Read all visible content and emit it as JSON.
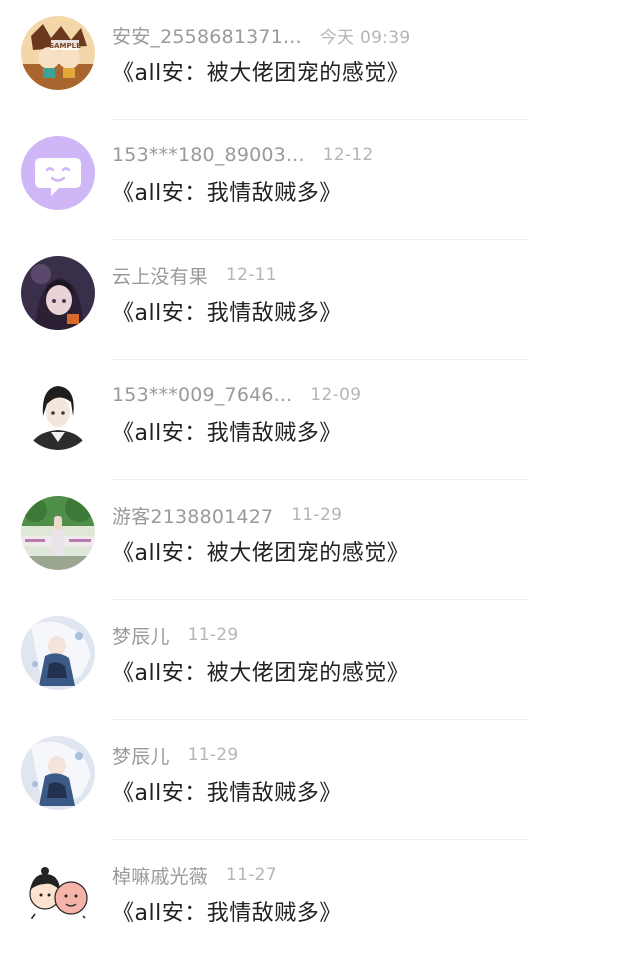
{
  "comments": [
    {
      "username": "安安_2558681371...",
      "time": "今天 09:39",
      "message": "《all安：被大佬团宠的感觉》",
      "avatar": "anime-sample-avatar",
      "avatar_text": "SAMPLE"
    },
    {
      "username": "153***180_89003...",
      "time": "12-12",
      "message": "《all安：我情敌贼多》",
      "avatar": "chat-bubble-avatar"
    },
    {
      "username": "云上没有果",
      "time": "12-11",
      "message": "《all安：我情敌贼多》",
      "avatar": "anime-girl-avatar"
    },
    {
      "username": "153***009_7646...",
      "time": "12-09",
      "message": "《all安：我情敌贼多》",
      "avatar": "anime-boy-avatar"
    },
    {
      "username": "游客2138801427",
      "time": "11-29",
      "message": "《all安：被大佬团宠的感觉》",
      "avatar": "photo-avatar"
    },
    {
      "username": "梦辰儿",
      "time": "11-29",
      "message": "《all安：被大佬团宠的感觉》",
      "avatar": "anime-white-hair-avatar"
    },
    {
      "username": "梦辰儿",
      "time": "11-29",
      "message": "《all安：我情敌贼多》",
      "avatar": "anime-white-hair-avatar"
    },
    {
      "username": "棹嘛戚光薇",
      "time": "11-27",
      "message": "《all安：我情敌贼多》",
      "avatar": "cartoon-couple-avatar"
    }
  ],
  "colors": {
    "username": "#9a9a9a",
    "time": "#b5b5b5",
    "message": "#222222",
    "divider": "#eeeeee",
    "chat_avatar_bg": "#cfb6f6"
  }
}
